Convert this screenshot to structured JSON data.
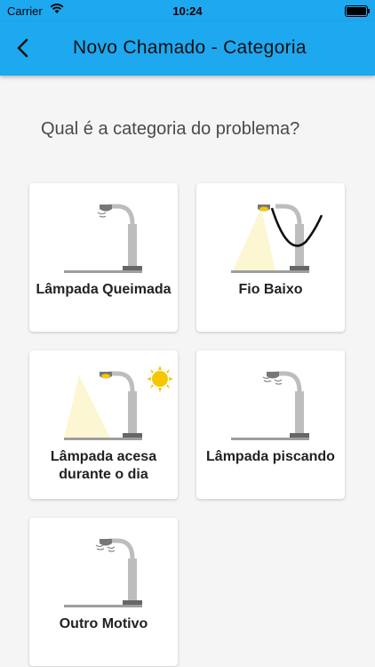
{
  "status_bar": {
    "carrier": "Carrier",
    "time": "10:24"
  },
  "header": {
    "title": "Novo Chamado - Categoria"
  },
  "question": "Qual é a categoria do problema?",
  "categories": [
    {
      "label": "Lâmpada Queimada"
    },
    {
      "label": "Fio Baixo"
    },
    {
      "label": "Lâmpada acesa durante o dia"
    },
    {
      "label": "Lâmpada piscando"
    },
    {
      "label": "Outro Motivo"
    }
  ],
  "colors": {
    "primary": "#1ea8f0",
    "lamp_light": "#fdf6d3",
    "sun": "#f6c700"
  }
}
